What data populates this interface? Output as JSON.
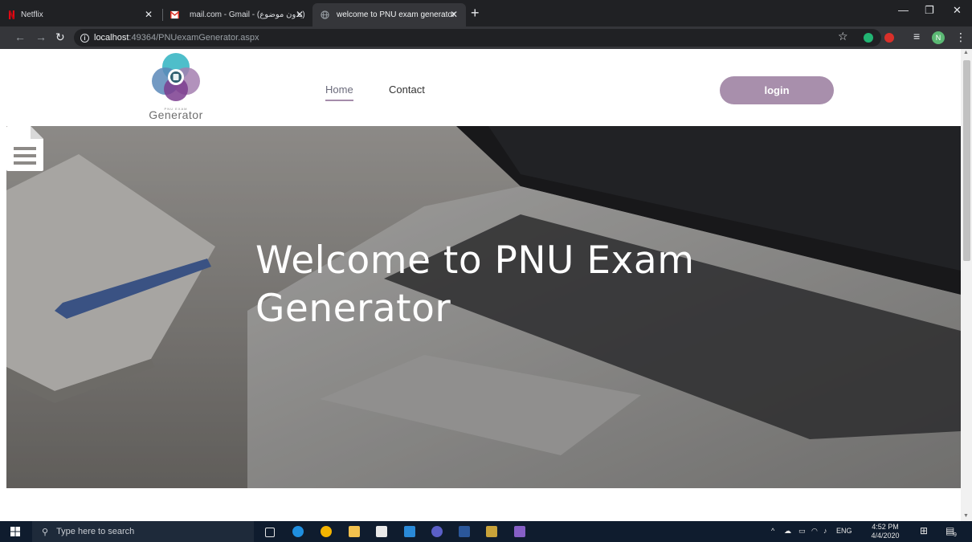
{
  "browser": {
    "tabs": [
      {
        "title": "Netflix",
        "active": false,
        "favicon": "netflix-icon"
      },
      {
        "title": "mail.com - Gmail - (بدون موضوع)",
        "active": false,
        "favicon": "gmail-icon"
      },
      {
        "title": "welcome to PNU exam generator",
        "active": true,
        "favicon": "globe-icon"
      }
    ],
    "new_tab_label": "+",
    "address": {
      "host": "localhost",
      "rest": ":49364/PNUexamGenerator.aspx"
    },
    "profile_initial": "N"
  },
  "site": {
    "logo": {
      "tagline": "PNU EXAM",
      "wordmark": "Generator"
    },
    "nav": {
      "home": "Home",
      "contact": "Contact"
    },
    "login_label": "login",
    "hero_title": "Welcome to PNU Exam Generator",
    "hero_icon": "document-icon"
  },
  "taskbar": {
    "search_placeholder": "Type here to search",
    "language": "ENG",
    "time": "4:52 PM",
    "date": "4/4/2020",
    "notification_count": "9"
  },
  "colors": {
    "accent": "#a88fac",
    "browser_dark": "#202124",
    "taskbar": "#0f1c2e"
  }
}
